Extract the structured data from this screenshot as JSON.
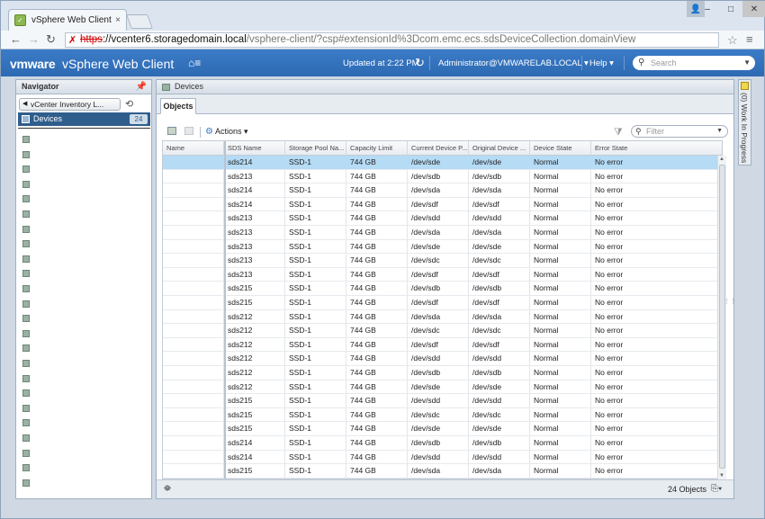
{
  "browser": {
    "tab_title": "vSphere Web Client",
    "tab_close": "×",
    "url_scheme": "https",
    "url_host": "://vcenter6.storagedomain.local",
    "url_path": "/vsphere-client/?csp#extensionId%3Dcom.emc.ecs.sdsDeviceCollection.domainView"
  },
  "header": {
    "logo": "vmware",
    "title": "vSphere Web Client",
    "updated": "Updated at 2:22 PM",
    "user": "Administrator@VMWARELAB.LOCAL ▾",
    "help": "Help ▾",
    "search_placeholder": "Search"
  },
  "navigator": {
    "title": "Navigator",
    "breadcrumb": "vCenter Inventory L...",
    "selected_label": "Devices",
    "selected_count": "24",
    "item_count": 24
  },
  "main": {
    "title": "Devices",
    "tab": "Objects",
    "actions_label": "Actions ▾",
    "filter_placeholder": "Filter",
    "objects_count": "24 Objects",
    "columns": [
      "Name",
      "SDS Name",
      "Storage Pool Na...",
      "Capacity Limit",
      "Current Device P...",
      "Original Device ...",
      "Device State",
      "Error State"
    ],
    "rows": [
      [
        "",
        "sds214",
        "SSD-1",
        "744 GB",
        "/dev/sde",
        "/dev/sde",
        "Normal",
        "No error"
      ],
      [
        "",
        "sds213",
        "SSD-1",
        "744 GB",
        "/dev/sdb",
        "/dev/sdb",
        "Normal",
        "No error"
      ],
      [
        "",
        "sds214",
        "SSD-1",
        "744 GB",
        "/dev/sda",
        "/dev/sda",
        "Normal",
        "No error"
      ],
      [
        "",
        "sds214",
        "SSD-1",
        "744 GB",
        "/dev/sdf",
        "/dev/sdf",
        "Normal",
        "No error"
      ],
      [
        "",
        "sds213",
        "SSD-1",
        "744 GB",
        "/dev/sdd",
        "/dev/sdd",
        "Normal",
        "No error"
      ],
      [
        "",
        "sds213",
        "SSD-1",
        "744 GB",
        "/dev/sda",
        "/dev/sda",
        "Normal",
        "No error"
      ],
      [
        "",
        "sds213",
        "SSD-1",
        "744 GB",
        "/dev/sde",
        "/dev/sde",
        "Normal",
        "No error"
      ],
      [
        "",
        "sds213",
        "SSD-1",
        "744 GB",
        "/dev/sdc",
        "/dev/sdc",
        "Normal",
        "No error"
      ],
      [
        "",
        "sds213",
        "SSD-1",
        "744 GB",
        "/dev/sdf",
        "/dev/sdf",
        "Normal",
        "No error"
      ],
      [
        "",
        "sds215",
        "SSD-1",
        "744 GB",
        "/dev/sdb",
        "/dev/sdb",
        "Normal",
        "No error"
      ],
      [
        "",
        "sds215",
        "SSD-1",
        "744 GB",
        "/dev/sdf",
        "/dev/sdf",
        "Normal",
        "No error"
      ],
      [
        "",
        "sds212",
        "SSD-1",
        "744 GB",
        "/dev/sda",
        "/dev/sda",
        "Normal",
        "No error"
      ],
      [
        "",
        "sds212",
        "SSD-1",
        "744 GB",
        "/dev/sdc",
        "/dev/sdc",
        "Normal",
        "No error"
      ],
      [
        "",
        "sds212",
        "SSD-1",
        "744 GB",
        "/dev/sdf",
        "/dev/sdf",
        "Normal",
        "No error"
      ],
      [
        "",
        "sds212",
        "SSD-1",
        "744 GB",
        "/dev/sdd",
        "/dev/sdd",
        "Normal",
        "No error"
      ],
      [
        "",
        "sds212",
        "SSD-1",
        "744 GB",
        "/dev/sdb",
        "/dev/sdb",
        "Normal",
        "No error"
      ],
      [
        "",
        "sds212",
        "SSD-1",
        "744 GB",
        "/dev/sde",
        "/dev/sde",
        "Normal",
        "No error"
      ],
      [
        "",
        "sds215",
        "SSD-1",
        "744 GB",
        "/dev/sdd",
        "/dev/sdd",
        "Normal",
        "No error"
      ],
      [
        "",
        "sds215",
        "SSD-1",
        "744 GB",
        "/dev/sdc",
        "/dev/sdc",
        "Normal",
        "No error"
      ],
      [
        "",
        "sds215",
        "SSD-1",
        "744 GB",
        "/dev/sde",
        "/dev/sde",
        "Normal",
        "No error"
      ],
      [
        "",
        "sds214",
        "SSD-1",
        "744 GB",
        "/dev/sdb",
        "/dev/sdb",
        "Normal",
        "No error"
      ],
      [
        "",
        "sds214",
        "SSD-1",
        "744 GB",
        "/dev/sdd",
        "/dev/sdd",
        "Normal",
        "No error"
      ],
      [
        "",
        "sds215",
        "SSD-1",
        "744 GB",
        "/dev/sda",
        "/dev/sda",
        "Normal",
        "No error"
      ]
    ]
  },
  "wip": {
    "label": "(0)  Work In Progress"
  },
  "colors": {
    "header_blue": "#2d6ab3",
    "selected_row": "#b5dbf5",
    "nav_selected": "#2f5d8c"
  }
}
